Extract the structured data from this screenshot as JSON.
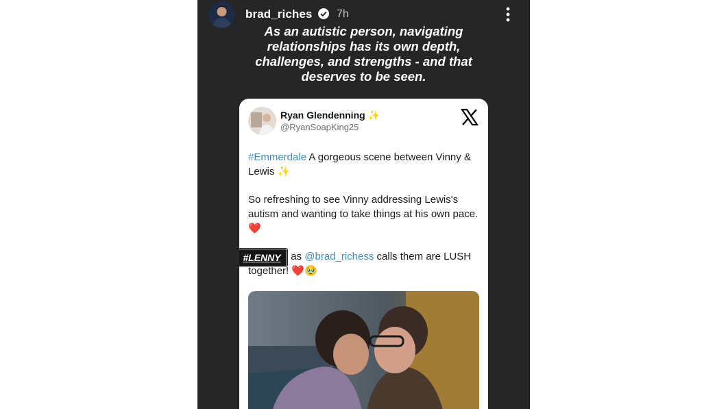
{
  "story": {
    "username": "brad_riches",
    "time": "7h",
    "caption": [
      "As an autistic person, navigating",
      "relationships has its own depth,",
      "challenges, and strengths - and that",
      "deserves to be seen."
    ],
    "sticker": "#LENNY"
  },
  "tweet": {
    "name": "Ryan Glendenning",
    "name_emoji": "✨",
    "handle": "@RyanSoapKing25",
    "hashtag": "#Emmerdale",
    "line1": " A gorgeous scene between Vinny & Lewis ",
    "line1_emoji": "✨",
    "line2": "So refreshing to see Vinny addressing Lewis's autism and wanting to take things at his own pace. ",
    "line3_pre": "#LENNY as ",
    "mention": "@brad_richess",
    "line3_post": " calls them are LUSH together! ",
    "heart": "❤️",
    "pleading": "🥹"
  },
  "colors": {
    "story_bg": "#262626",
    "link": "#3a8fbf",
    "verified": "#ffffff"
  },
  "icons": [
    "verified-badge-icon",
    "more-options-icon",
    "x-logo-icon"
  ]
}
